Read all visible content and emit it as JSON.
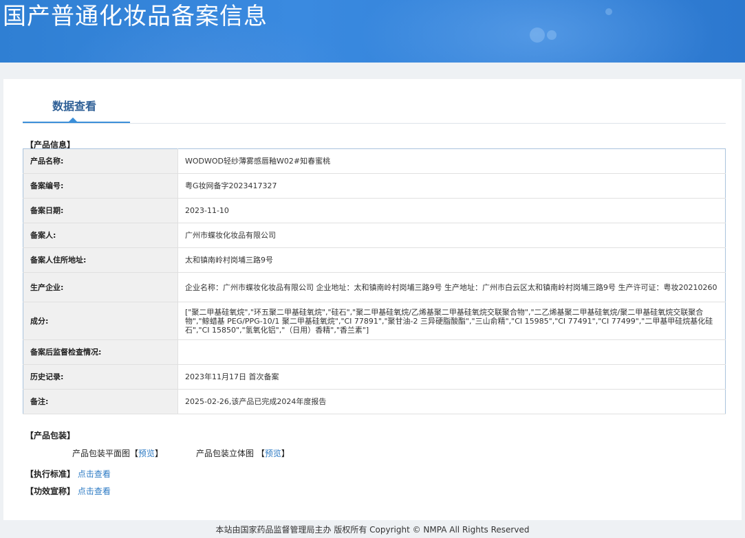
{
  "header": {
    "title": "国产普通化妆品备案信息"
  },
  "tabs": [
    {
      "label": "数据查看"
    }
  ],
  "product_info": {
    "section_label": "【产品信息】",
    "rows": [
      {
        "label": "产品名称:",
        "value": "WODWOD轻纱薄雾感唇釉W02#知春蜜桃"
      },
      {
        "label": "备案编号:",
        "value": "粤G妆网备字2023417327"
      },
      {
        "label": "备案日期:",
        "value": "2023-11-10"
      },
      {
        "label": "备案人:",
        "value": "广州市蝶妆化妆品有限公司"
      },
      {
        "label": "备案人住所地址:",
        "value": "太和镇南岭村岗埔三路9号"
      },
      {
        "label": "生产企业:",
        "value": "企业名称：广州市蝶妆化妆品有限公司 企业地址：太和镇南岭村岗埔三路9号 生产地址：广州市白云区太和镇南岭村岗埔三路9号 生产许可证：粤妆20210260"
      },
      {
        "label": "成分:",
        "value": "[\"聚二甲基硅氧烷\",\"环五聚二甲基硅氧烷\",\"硅石\",\"聚二甲基硅氧烷/乙烯基聚二甲基硅氧烷交联聚合物\",\"二乙烯基聚二甲基硅氧烷/聚二甲基硅氧烷交联聚合物\",\"鲸蜡基 PEG/PPG-10/1 聚二甲基硅氧烷\",\"CI 77891\",\"聚甘油-2 三异硬脂酸酯\",\"三山俞精\",\"CI 15985\",\"CI 77491\",\"CI 77499\",\"二甲基甲硅烷基化硅石\",\"CI 15850\",\"氢氧化铝\",\"（日用）香精\",\"香兰素\"]"
      },
      {
        "label": "备案后监督检查情况:",
        "value": ""
      },
      {
        "label": "历史记录:",
        "value": "2023年11月17日 首次备案"
      },
      {
        "label": "备注:",
        "value": "2025-02-26,该产品已完成2024年度报告"
      }
    ]
  },
  "packaging": {
    "section_label": "【产品包装】",
    "flat_label": "产品包装平面图",
    "flat_link": "预览",
    "solid_label": "产品包装立体图",
    "solid_link": "预览",
    "bracket_open": "【",
    "bracket_close": "】"
  },
  "standard": {
    "section_label": "【执行标准】",
    "link": "点击查看"
  },
  "efficacy": {
    "section_label": "【功效宣称】",
    "link": "点击查看"
  },
  "footer": {
    "text": "本站由国家药品监督管理局主办 版权所有 Copyright © NMPA All Rights Reserved"
  }
}
